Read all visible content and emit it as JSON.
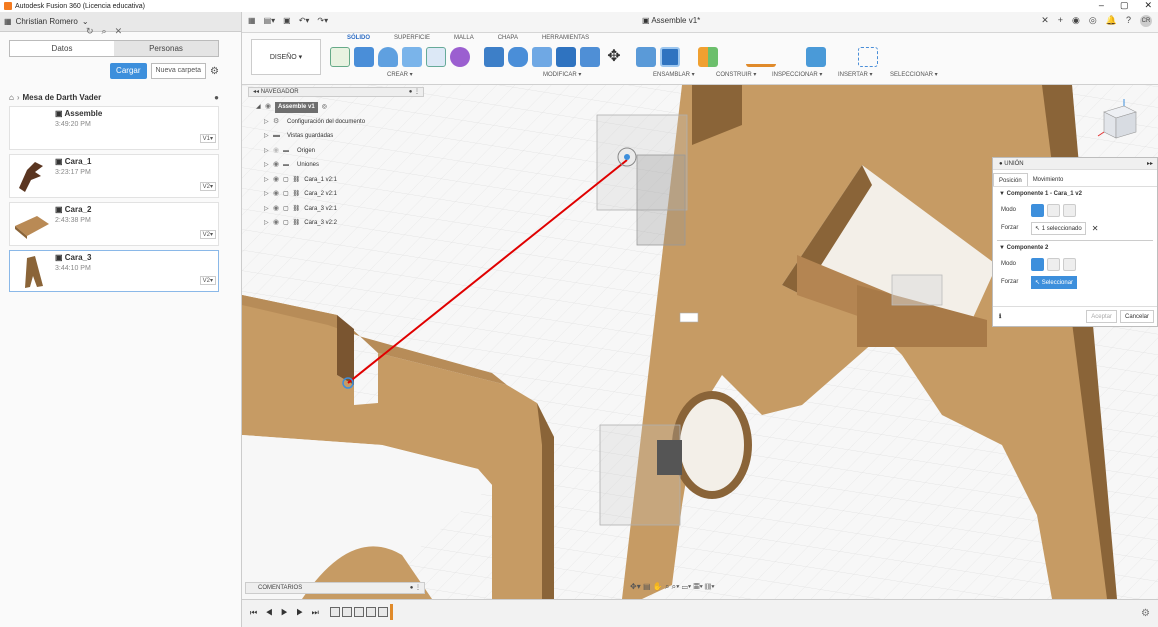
{
  "window": {
    "title": "Autodesk Fusion 360 (Licencia educativa)",
    "controls": [
      "–",
      "▢",
      "✕"
    ]
  },
  "leftpanel": {
    "user": "Christian Romero",
    "tabs": [
      "Datos",
      "Personas"
    ],
    "upload_label": "Cargar",
    "new_folder_label": "Nueva carpeta",
    "project": "Mesa de Darth Vader",
    "files": [
      {
        "name": "Assemble",
        "time": "3:49:20 PM",
        "version": "V1▾"
      },
      {
        "name": "Cara_1",
        "time": "3:23:17 PM",
        "version": "V2▾"
      },
      {
        "name": "Cara_2",
        "time": "2:43:38 PM",
        "version": "V2▾"
      },
      {
        "name": "Cara_3",
        "time": "3:44:10 PM",
        "version": "V2▾"
      }
    ]
  },
  "doc": {
    "title": "Assemble v1*"
  },
  "user_initials": "CR",
  "toolbar": {
    "design_label": "DISEÑO ▾",
    "tabs": [
      "SÓLIDO",
      "SUPERFICIE",
      "MALLA",
      "CHAPA",
      "HERRAMIENTAS"
    ],
    "groups": [
      "CREAR ▾",
      "MODIFICAR ▾",
      "ENSAMBLAR ▾",
      "CONSTRUIR ▾",
      "INSPECCIONAR ▾",
      "INSERTAR ▾",
      "SELECCIONAR ▾"
    ]
  },
  "navigator": {
    "title": "NAVEGADOR",
    "root": "Assemble v1",
    "items": [
      "Configuración del documento",
      "Vistas guardadas",
      "Origen",
      "Uniones",
      "Cara_1 v2:1",
      "Cara_2 v2:1",
      "Cara_3 v2:1",
      "Cara_3 v2:2"
    ]
  },
  "union": {
    "title": "UNIÓN",
    "tabs": [
      "Posición",
      "Movimiento"
    ],
    "comp1_title": "Componente 1 - Cara_1 v2",
    "comp2_title": "Componente 2",
    "mode_label": "Modo",
    "force_label": "Forzar",
    "comp1_selection": "1 seleccionado",
    "comp2_selection": "Seleccionar",
    "ok_label": "Aceptar",
    "cancel_label": "Cancelar"
  },
  "comments": {
    "title": "COMENTARIOS"
  },
  "colors": {
    "accent": "#3d8fdc",
    "wood": "#c9a06a",
    "wood_dark": "#8a6438",
    "joint_line": "#e00000"
  }
}
